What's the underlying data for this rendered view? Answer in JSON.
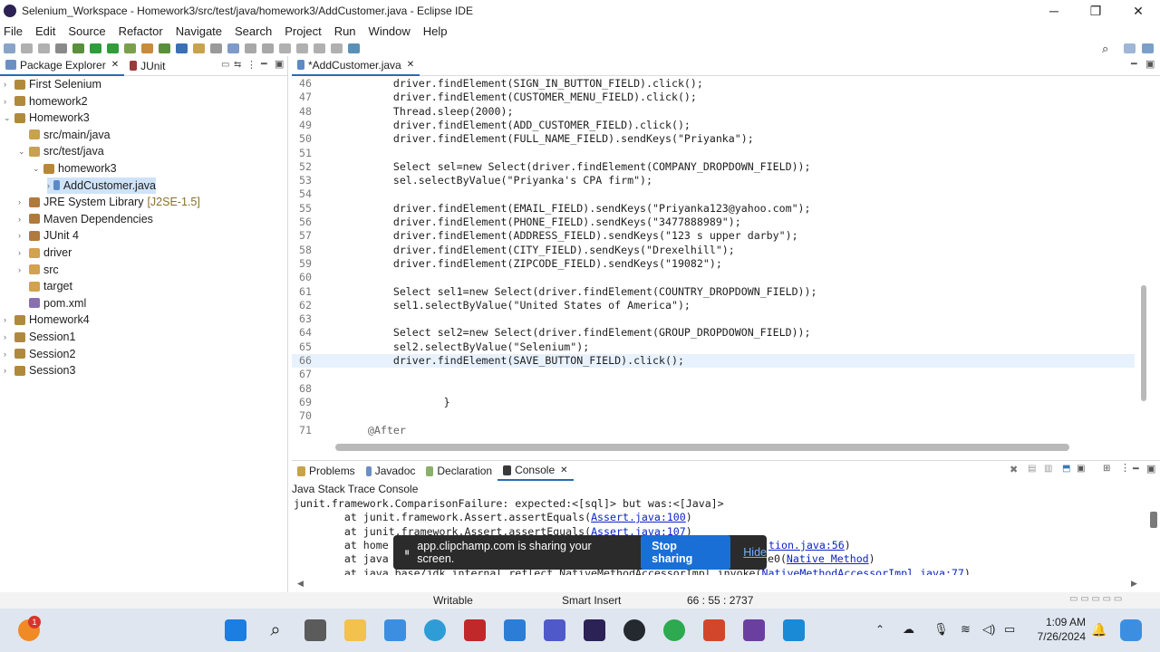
{
  "window": {
    "title": "Selenium_Workspace - Homework3/src/test/java/homework3/AddCustomer.java - Eclipse IDE",
    "minimize": "─",
    "maximize": "❐",
    "close": "✕"
  },
  "menu": [
    "File",
    "Edit",
    "Source",
    "Refactor",
    "Navigate",
    "Search",
    "Project",
    "Run",
    "Window",
    "Help"
  ],
  "left": {
    "tab1": "Package Explorer",
    "tab2": "JUnit",
    "tree": [
      {
        "label": "First Selenium",
        "twisty": "›",
        "icon": "project-icon"
      },
      {
        "label": "homework2",
        "twisty": "›",
        "icon": "project-icon"
      },
      {
        "label": "Homework3",
        "twisty": "⌄",
        "icon": "project-icon"
      },
      {
        "label": "src/main/java",
        "twisty": "",
        "icon": "source-folder-icon"
      },
      {
        "label": "src/test/java",
        "twisty": "⌄",
        "icon": "source-folder-icon"
      },
      {
        "label": "homework3",
        "twisty": "⌄",
        "icon": "package-icon"
      },
      {
        "label": "AddCustomer.java",
        "twisty": "›",
        "icon": "java-file-icon"
      },
      {
        "label": "JRE System Library",
        "suffix": "[J2SE-1.5]",
        "twisty": "›",
        "icon": "library-icon"
      },
      {
        "label": "Maven Dependencies",
        "twisty": "›",
        "icon": "library-icon"
      },
      {
        "label": "JUnit 4",
        "twisty": "›",
        "icon": "library-icon"
      },
      {
        "label": "driver",
        "twisty": "›",
        "icon": "folder-icon"
      },
      {
        "label": "src",
        "twisty": "›",
        "icon": "folder-icon"
      },
      {
        "label": "target",
        "twisty": "",
        "icon": "folder-icon"
      },
      {
        "label": "pom.xml",
        "twisty": "",
        "icon": "xml-file-icon"
      },
      {
        "label": "Homework4",
        "twisty": "›",
        "icon": "project-icon"
      },
      {
        "label": "Session1",
        "twisty": "›",
        "icon": "project-icon"
      },
      {
        "label": "Session2",
        "twisty": "›",
        "icon": "project-icon"
      },
      {
        "label": "Session3",
        "twisty": "›",
        "icon": "project-icon"
      }
    ]
  },
  "editor": {
    "tab": "*AddCustomer.java",
    "lines": [
      {
        "n": "46",
        "t": "        driver.findElement(SIGN_IN_BUTTON_FIELD).click();"
      },
      {
        "n": "47",
        "t": "        driver.findElement(CUSTOMER_MENU_FIELD).click();"
      },
      {
        "n": "48",
        "t": "        Thread.sleep(2000);"
      },
      {
        "n": "49",
        "t": "        driver.findElement(ADD_CUSTOMER_FIELD).click();"
      },
      {
        "n": "50",
        "t": "        driver.findElement(FULL_NAME_FIELD).sendKeys(\"Priyanka\");"
      },
      {
        "n": "51",
        "t": ""
      },
      {
        "n": "52",
        "t": "        Select sel=new Select(driver.findElement(COMPANY_DROPDOWN_FIELD));"
      },
      {
        "n": "53",
        "t": "        sel.selectByValue(\"Priyanka's CPA firm\");"
      },
      {
        "n": "54",
        "t": ""
      },
      {
        "n": "55",
        "t": "        driver.findElement(EMAIL_FIELD).sendKeys(\"Priyanka123@yahoo.com\");"
      },
      {
        "n": "56",
        "t": "        driver.findElement(PHONE_FIELD).sendKeys(\"3477888989\");"
      },
      {
        "n": "57",
        "t": "        driver.findElement(ADDRESS_FIELD).sendKeys(\"123 s upper darby\");"
      },
      {
        "n": "58",
        "t": "        driver.findElement(CITY_FIELD).sendKeys(\"Drexelhill\");"
      },
      {
        "n": "59",
        "t": "        driver.findElement(ZIPCODE_FIELD).sendKeys(\"19082\");"
      },
      {
        "n": "60",
        "t": ""
      },
      {
        "n": "61",
        "t": "        Select sel1=new Select(driver.findElement(COUNTRY_DROPDOWN_FIELD));"
      },
      {
        "n": "62",
        "t": "        sel1.selectByValue(\"United States of America\");"
      },
      {
        "n": "63",
        "t": ""
      },
      {
        "n": "64",
        "t": "        Select sel2=new Select(driver.findElement(GROUP_DROPDOWON_FIELD));"
      },
      {
        "n": "65",
        "t": "        sel2.selectByValue(\"Selenium\");"
      },
      {
        "n": "66",
        "t": "        driver.findElement(SAVE_BUTTON_FIELD).click();"
      },
      {
        "n": "67",
        "t": ""
      },
      {
        "n": "68",
        "t": ""
      },
      {
        "n": "69",
        "t": "                }"
      },
      {
        "n": "70",
        "t": ""
      },
      {
        "n": "71",
        "t": "    @After"
      }
    ]
  },
  "bottom": {
    "tabs": [
      "Problems",
      "Javadoc",
      "Declaration",
      "Console"
    ],
    "console_title": "Java Stack Trace Console",
    "lines": [
      {
        "pre": "junit.framework.ComparisonFailure: expected:<[sql]> but was:<[Java]>",
        "link": "",
        "post": ""
      },
      {
        "pre": "        at junit.framework.Assert.assertEquals(",
        "link": "Assert.java:100",
        "post": ")"
      },
      {
        "pre": "        at junit.framework.Assert.assertEquals(",
        "link": "Assert.java:107",
        "post": ")"
      },
      {
        "pre": "        at home",
        "link": "",
        "post": ""
      },
      {
        "pre": "        at java",
        "link": "",
        "post": ""
      },
      {
        "pre": "        at java.base/jdk.internal.reflect.NativeMethodAccessorImpl.invoke(",
        "link": "NativeMethodAccessorImpl.java:77",
        "post": ")"
      }
    ],
    "partial1": "tion.java:56",
    "partial1_post": ")",
    "partial2_pre": "ke0(",
    "partial2_link": "Native Method",
    "partial2_post": ")"
  },
  "status": {
    "writable": "Writable",
    "insert": "Smart Insert",
    "position": "66 : 55 : 2737"
  },
  "share": {
    "message": "app.clipchamp.com is sharing your screen.",
    "stop": "Stop sharing",
    "hide": "Hide"
  },
  "taskbar": {
    "time": "1:09 AM",
    "date": "7/26/2024",
    "badge": "1"
  },
  "colors": {
    "accent": "#2a6ab6",
    "stop_button": "#1a6fd6",
    "keyword": "#7f0055",
    "string": "#2a00ff"
  }
}
